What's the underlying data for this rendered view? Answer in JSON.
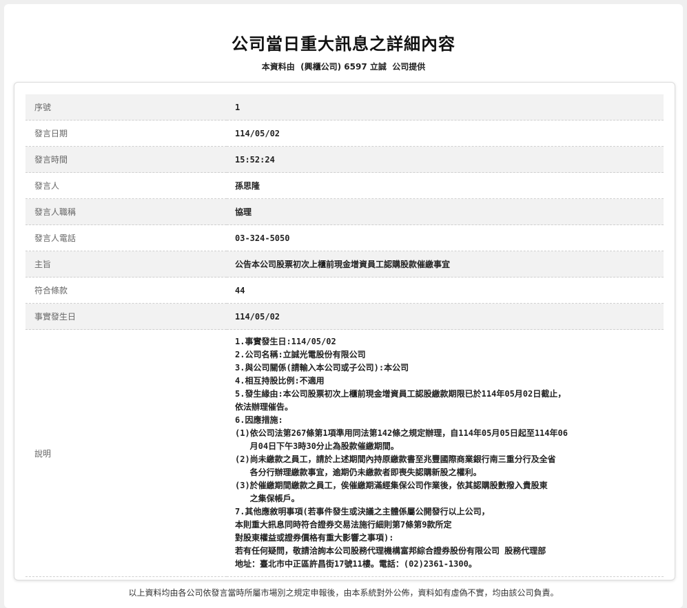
{
  "header": {
    "title": "公司當日重大訊息之詳細內容",
    "provider": "本資料由  (興櫃公司) 6597 立誠  公司提供"
  },
  "rows": [
    {
      "label": "序號",
      "value": "1"
    },
    {
      "label": "發言日期",
      "value": "114/05/02"
    },
    {
      "label": "發言時間",
      "value": "15:52:24"
    },
    {
      "label": "發言人",
      "value": "孫思隆"
    },
    {
      "label": "發言人職稱",
      "value": "協理"
    },
    {
      "label": "發言人電話",
      "value": "03-324-5050"
    },
    {
      "label": "主旨",
      "value": "公告本公司股票初次上櫃前現金增資員工認購股款催繳事宜"
    },
    {
      "label": "符合條款",
      "value": "44"
    },
    {
      "label": "事實發生日",
      "value": "114/05/02"
    }
  ],
  "description": {
    "label": "說明",
    "text": "1.事實發生日:114/05/02\n2.公司名稱:立誠光電股份有限公司\n3.與公司關係(請輸入本公司或子公司):本公司\n4.相互持股比例:不適用\n5.發生緣由:本公司股票初次上櫃前現金增資員工認股繳款期限已於114年05月02日截止，\n依法辦理催告。\n6.因應措施:\n(1)依公司法第267條第1項準用同法第142條之規定辦理，自114年05月05日起至114年06\n   月04日下午3時30分止為股款催繳期間。\n(2)尚未繳款之員工，請於上述期間內持原繳款書至兆豐國際商業銀行南三重分行及全省\n   各分行辦理繳款事宜，逾期仍未繳款者即喪失認購新股之權利。\n(3)於催繳期間繳款之員工，俟催繳期滿經集保公司作業後，依其認購股數撥入貴股東\n   之集保帳戶。\n7.其他應敘明事項(若事件發生或決議之主體係屬公開發行以上公司，\n本則重大訊息同時符合證券交易法施行細則第7條第9款所定\n對股東權益或證券價格有重大影響之事項):\n若有任何疑問，敬請洽詢本公司股務代理機構富邦綜合證券股份有限公司 股務代理部\n地址：臺北市中正區許昌街17號11樓。電話：(02)2361-1300。"
  },
  "footer": {
    "note": "以上資料均由各公司依發言當時所屬市場別之規定申報後，由本系統對外公佈，資料如有虛偽不實，均由該公司負責。"
  }
}
